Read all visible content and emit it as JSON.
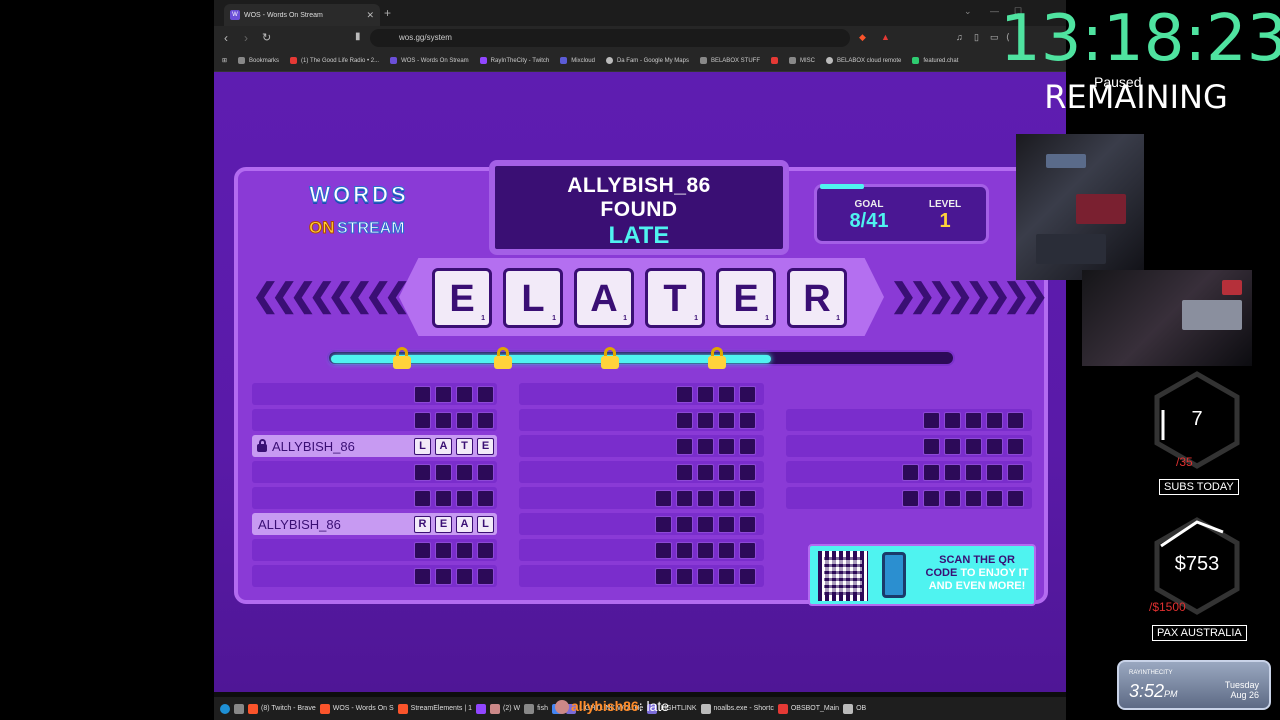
{
  "browser": {
    "tab_title": "WOS - Words On Stream",
    "tab_favicon": "W",
    "url": "wos.gg/system",
    "bookmarks": [
      {
        "label": "Bookmarks",
        "color": "#888888"
      },
      {
        "label": "(1) The Good Life Radio • 2...",
        "color": "#e53935"
      },
      {
        "label": "WOS - Words On Stream",
        "color": "#6b4fd8"
      },
      {
        "label": "RayInTheCity - Twitch",
        "color": "#9146ff"
      },
      {
        "label": "Mixcloud",
        "color": "#5b5bd6"
      },
      {
        "label": "Da Fam - Google My Maps",
        "color": "#bbbbbb"
      },
      {
        "label": "BELABOX STUFF",
        "color": "#888888"
      },
      {
        "label": "",
        "color": "#e53935"
      },
      {
        "label": "MISC",
        "color": "#888888"
      },
      {
        "label": "BELABOX cloud remote",
        "color": "#bbbbbb"
      },
      {
        "label": "featured.chat",
        "color": "#2ecc71"
      }
    ]
  },
  "game": {
    "logo_line1": "WORDS",
    "logo_on": "ON",
    "logo_stream": "STREAM",
    "found_player": "ALLYBISH_86",
    "found_label": "FOUND",
    "found_word": "LATE",
    "goal_label": "GOAL",
    "goal_value": "8/41",
    "level_label": "LEVEL",
    "level_value": "1",
    "letters": [
      {
        "char": "E",
        "pts": "1"
      },
      {
        "char": "L",
        "pts": "1"
      },
      {
        "char": "A",
        "pts": "1"
      },
      {
        "char": "T",
        "pts": "1"
      },
      {
        "char": "E",
        "pts": "1"
      },
      {
        "char": "R",
        "pts": "1"
      }
    ],
    "progress_fraction": 0.71,
    "qr_line1": "SCAN THE QR",
    "qr_line2a": "CODE ",
    "qr_line2b": "TO ENJOY IT",
    "qr_line3": "AND EVEN MORE!",
    "col1_rows": [
      {
        "name": "",
        "letters": [
          "",
          "",
          "",
          ""
        ],
        "locked": false
      },
      {
        "name": "",
        "letters": [
          "",
          "",
          "",
          ""
        ],
        "locked": false
      },
      {
        "name": "ALLYBISH_86",
        "letters": [
          "L",
          "A",
          "T",
          "E"
        ],
        "locked": true
      },
      {
        "name": "",
        "letters": [
          "",
          "",
          "",
          ""
        ],
        "locked": false
      },
      {
        "name": "",
        "letters": [
          "",
          "",
          "",
          ""
        ],
        "locked": false
      },
      {
        "name": "ALLYBISH_86",
        "letters": [
          "R",
          "E",
          "A",
          "L"
        ],
        "locked": false
      },
      {
        "name": "",
        "letters": [
          "",
          "",
          "",
          ""
        ],
        "locked": false
      },
      {
        "name": "",
        "letters": [
          "",
          "",
          "",
          ""
        ],
        "locked": false
      }
    ]
  },
  "taskbar": {
    "items": [
      {
        "label": "(8) Twitch - Brave",
        "color": "#fb542b"
      },
      {
        "label": "WOS - Words On S",
        "color": "#fb542b"
      },
      {
        "label": "StreamElements | 1",
        "color": "#fb542b"
      },
      {
        "label": "",
        "color": "#9146ff"
      },
      {
        "label": "(2) W",
        "color": "#cc8888"
      },
      {
        "label": "fish",
        "color": "#888888"
      },
      {
        "label": "",
        "color": "#4285f4"
      },
      {
        "label": "LIGHTLINK WDL He",
        "color": "#7b6cd9"
      },
      {
        "label": "LIGHTLINK",
        "color": "#7b6cd9"
      },
      {
        "label": "noalbs.exe - Shortc",
        "color": "#bbbbbb"
      },
      {
        "label": "OBSBOT_Main",
        "color": "#e53935"
      },
      {
        "label": "OB",
        "color": "#bbbbbb"
      }
    ]
  },
  "chat": {
    "user": "allybish86",
    "message": ": late"
  },
  "overlay": {
    "timer": "13:18:23",
    "paused": "Paused",
    "remaining": "REMAINING",
    "subs_value": "7",
    "subs_goal": "/35",
    "subs_label": "SUBS TODAY",
    "money_value": "$753",
    "money_goal": "/$1500",
    "money_label": "PAX AUSTRALIA",
    "clock_channel": "RAYINTHECITY",
    "clock_time": "3:52",
    "clock_ampm": "PM",
    "clock_weekday": "Tuesday",
    "clock_date": "Aug 26"
  }
}
